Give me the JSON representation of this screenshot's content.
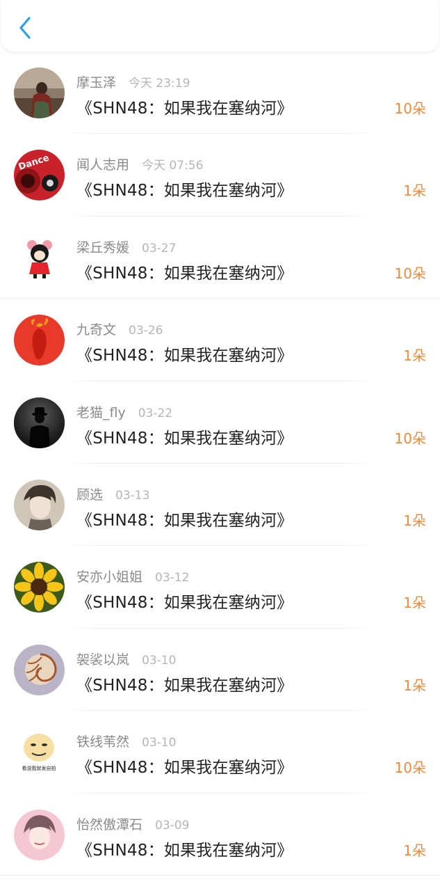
{
  "header": {
    "back_icon": "chevron-left-icon",
    "accent": "#2f9be0"
  },
  "colors": {
    "count": "#f08a3a",
    "name": "#8a8a8a",
    "time": "#b5b5b5",
    "title": "#222222"
  },
  "items": [
    {
      "name": "摩玉泽",
      "time": "今天 23:19",
      "title": "《SHN48：如果我在塞纳河》",
      "count": "10朵",
      "avatar": "photo-woman-avatar"
    },
    {
      "name": "闻人志用",
      "time": "今天 07:56",
      "title": "《SHN48：如果我在塞纳河》",
      "count": "1朵",
      "avatar": "dance-avatar"
    },
    {
      "name": "梁丘秀媛",
      "time": "03-27",
      "title": "《SHN48：如果我在塞纳河》",
      "count": "10朵",
      "avatar": "cartoon-girl-avatar"
    },
    {
      "name": "九奇文",
      "time": "03-26",
      "title": "《SHN48：如果我在塞纳河》",
      "count": "1朵",
      "avatar": "red-pepper-avatar"
    },
    {
      "name": "老猫_fly",
      "time": "03-22",
      "title": "《SHN48：如果我在塞纳河》",
      "count": "10朵",
      "avatar": "dark-figure-avatar"
    },
    {
      "name": "顾选",
      "time": "03-13",
      "title": "《SHN48：如果我在塞纳河》",
      "count": "1朵",
      "avatar": "anime-man-avatar"
    },
    {
      "name": "安亦小姐姐",
      "time": "03-12",
      "title": "《SHN48：如果我在塞纳河》",
      "count": "1朵",
      "avatar": "sunflower-avatar"
    },
    {
      "name": "袈裟以岚",
      "time": "03-10",
      "title": "《SHN48：如果我在塞纳河》",
      "count": "1朵",
      "avatar": "nautilus-shell-avatar"
    },
    {
      "name": "铁线苇然",
      "time": "03-10",
      "title": "《SHN48：如果我在塞纳河》",
      "count": "10朵",
      "avatar": "meme-face-avatar",
      "avatar_caption": "看说我就发自拍"
    },
    {
      "name": "怡然傲潭石",
      "time": "03-09",
      "title": "《SHN48：如果我在塞纳河》",
      "count": "1朵",
      "avatar": "anime-boy-avatar"
    }
  ]
}
